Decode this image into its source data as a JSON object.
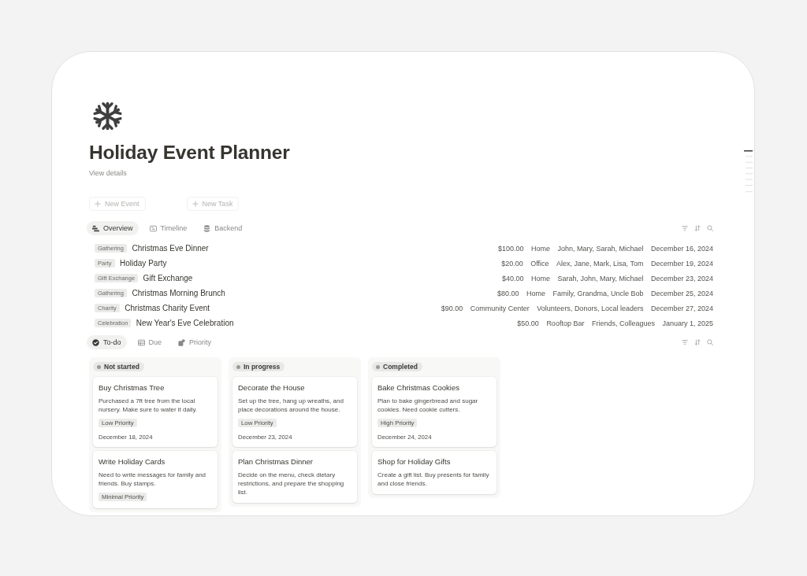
{
  "page": {
    "title": "Holiday Event Planner",
    "details_link": "View details"
  },
  "actions": [
    {
      "label": "New Event"
    },
    {
      "label": "New Task"
    }
  ],
  "events_view": {
    "tabs": [
      {
        "label": "Overview",
        "selected": true
      },
      {
        "label": "Timeline",
        "selected": false
      },
      {
        "label": "Backend",
        "selected": false
      }
    ],
    "rows": [
      {
        "category": "Gathering",
        "name": "Christmas Eve Dinner",
        "budget": "$100.00",
        "location": "Home",
        "guests": "John, Mary, Sarah, Michael",
        "date": "December 16, 2024"
      },
      {
        "category": "Party",
        "name": "Holiday Party",
        "budget": "$20.00",
        "location": "Office",
        "guests": "Alex, Jane, Mark, Lisa, Tom",
        "date": "December 19, 2024"
      },
      {
        "category": "Gift Exchange",
        "name": "Gift Exchange",
        "budget": "$40.00",
        "location": "Home",
        "guests": "Sarah, John, Mary, Michael",
        "date": "December 23, 2024"
      },
      {
        "category": "Gathering",
        "name": "Christmas Morning Brunch",
        "budget": "$80.00",
        "location": "Home",
        "guests": "Family, Grandma, Uncle Bob",
        "date": "December 25, 2024"
      },
      {
        "category": "Charity",
        "name": "Christmas Charity Event",
        "budget": "$90.00",
        "location": "Community Center",
        "guests": "Volunteers, Donors, Local leaders",
        "date": "December 27, 2024"
      },
      {
        "category": "Celebration",
        "name": "New Year's Eve Celebration",
        "budget": "$50.00",
        "location": "Rooftop Bar",
        "guests": "Friends, Colleagues",
        "date": "January 1, 2025"
      }
    ]
  },
  "tasks_view": {
    "tabs": [
      {
        "label": "To-do",
        "selected": true
      },
      {
        "label": "Due",
        "selected": false
      },
      {
        "label": "Priority",
        "selected": false
      }
    ],
    "columns": [
      {
        "status": "Not started",
        "cards": [
          {
            "title": "Buy Christmas Tree",
            "description": "Purchased a 7ft tree from the local nursery. Make sure to water it daily.",
            "priority": "Low Priority",
            "date": "December 18, 2024"
          },
          {
            "title": "Write Holiday Cards",
            "description": "Need to write messages for family and friends. Buy stamps.",
            "priority": "Minimal Priority"
          }
        ]
      },
      {
        "status": "In progress",
        "cards": [
          {
            "title": "Decorate the House",
            "description": "Set up the tree, hang up wreaths, and place decorations around the house.",
            "priority": "Low Priority",
            "date": "December 23, 2024"
          },
          {
            "title": "Plan Christmas Dinner",
            "description": "Decide on the menu, check dietary restrictions, and prepare the shopping list."
          }
        ]
      },
      {
        "status": "Completed",
        "cards": [
          {
            "title": "Bake Christmas Cookies",
            "description": "Plan to bake gingerbread and sugar cookies. Need cookie cutters.",
            "priority": "High Priority",
            "date": "December 24, 2024"
          },
          {
            "title": "Shop for Holiday Gifts",
            "description": "Create a gift list. Buy presents for family and close friends."
          }
        ]
      }
    ]
  }
}
